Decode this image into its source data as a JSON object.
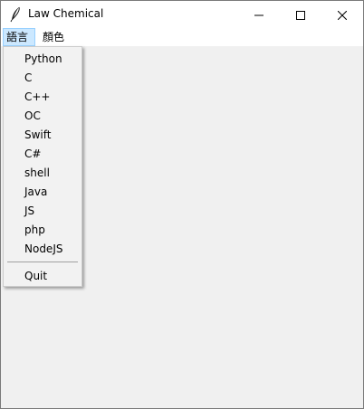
{
  "window": {
    "title": "Law Chemical"
  },
  "icons": {
    "app": "feather-icon",
    "minimize": "minimize-icon",
    "maximize": "maximize-icon",
    "close": "close-icon"
  },
  "menubar": {
    "items": [
      {
        "label": "語言"
      },
      {
        "label": "顏色"
      }
    ]
  },
  "dropdown": {
    "items": [
      {
        "label": "Python"
      },
      {
        "label": "C"
      },
      {
        "label": "C++"
      },
      {
        "label": "OC"
      },
      {
        "label": "Swift"
      },
      {
        "label": "C#"
      },
      {
        "label": "shell"
      },
      {
        "label": "Java"
      },
      {
        "label": "JS"
      },
      {
        "label": "php"
      },
      {
        "label": "NodeJS"
      }
    ],
    "quit_label": "Quit"
  },
  "colors": {
    "menu_highlight": "#cce8ff",
    "window_background": "#f0f0f0",
    "titlebar_background": "#ffffff"
  }
}
